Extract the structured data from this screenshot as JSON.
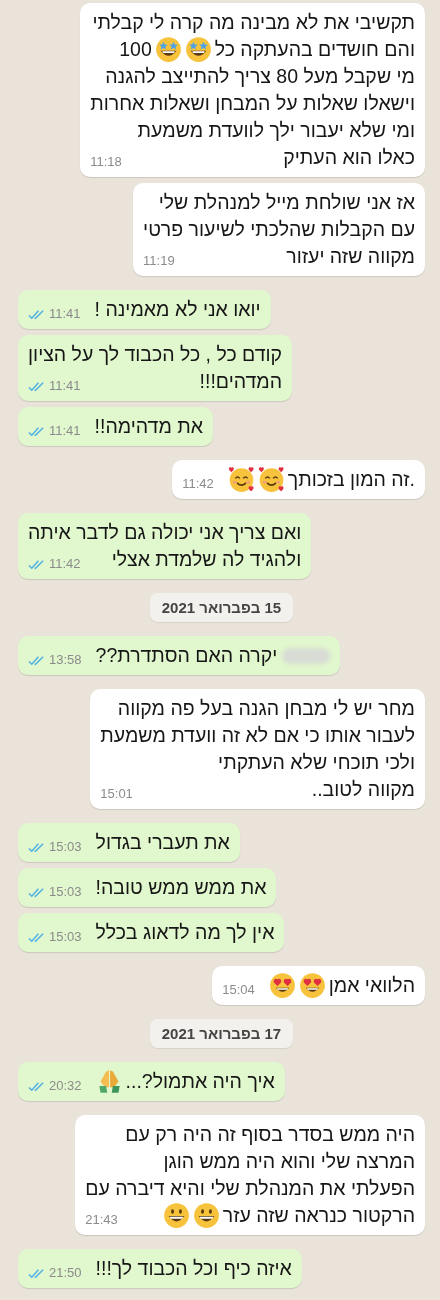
{
  "items": [
    {
      "kind": "message",
      "outgoing": false,
      "time": "11:18",
      "lines": [
        "תקשיבי את לא מבינה מה קרה לי קבלתי",
        [
          {
            "kind": "text",
            "text": "והם חושדים בהעתקה כל"
          },
          {
            "kind": "starstruck"
          },
          {
            "kind": "starstruck"
          },
          {
            "kind": "text",
            "text": "100"
          }
        ],
        "מי שקבל מעל 80 צריך להתייצב להגנה",
        "וישאלו שאלות על המבחן ושאלות אחרות",
        "ומי שלא יעבור ילך לוועדת משמעת",
        "כאלו הוא העתיק"
      ]
    },
    {
      "kind": "message",
      "outgoing": false,
      "time": "11:19",
      "lines": [
        "אז אני שולחת מייל למנהלת שלי",
        "עם הקבלות שהלכתי לשיעור פרטי",
        "מקווה שזה יעזור"
      ]
    },
    {
      "kind": "message",
      "outgoing": true,
      "time": "11:41",
      "lines": [
        "יואו אני לא מאמינה !"
      ]
    },
    {
      "kind": "message",
      "outgoing": true,
      "time": "11:41",
      "lines": [
        "קודם כל , כל הכבוד לך על הציון",
        "המדהים!!!"
      ]
    },
    {
      "kind": "message",
      "outgoing": true,
      "time": "11:41",
      "lines": [
        "את מדהימה!!"
      ]
    },
    {
      "kind": "message",
      "outgoing": false,
      "time": "11:42",
      "lines": [
        [
          {
            "kind": "text",
            "text": ".זה המון בזכותך"
          },
          {
            "kind": "hearts"
          },
          {
            "kind": "hearts"
          }
        ]
      ]
    },
    {
      "kind": "message",
      "outgoing": true,
      "time": "11:42",
      "lines": [
        "ואם צריך אני יכולה גם לדבר איתה",
        "ולהגיד לה שלמדת אצלי"
      ]
    },
    {
      "kind": "date",
      "text": "15 בפברואר 2021"
    },
    {
      "kind": "message",
      "outgoing": true,
      "time": "13:58",
      "lines": [
        [
          {
            "kind": "redacted"
          },
          {
            "kind": "text",
            "text": "יקרה האם הסתדרת??"
          }
        ]
      ]
    },
    {
      "kind": "message",
      "outgoing": false,
      "time": "15:01",
      "lines": [
        "מחר יש לי מבחן הגנה בעל פה מקווה",
        "לעבור אותו כי אם לא זה וועדת משמעת",
        "ולכי תוכחי שלא העתקתי",
        "מקווה לטוב.."
      ]
    },
    {
      "kind": "message",
      "outgoing": true,
      "time": "15:03",
      "lines": [
        "את תעברי בגדול"
      ]
    },
    {
      "kind": "message",
      "outgoing": true,
      "time": "15:03",
      "lines": [
        "את ממש ממש טובה!"
      ]
    },
    {
      "kind": "message",
      "outgoing": true,
      "time": "15:03",
      "lines": [
        "אין לך מה לדאוג בכלל"
      ]
    },
    {
      "kind": "message",
      "outgoing": false,
      "time": "15:04",
      "lines": [
        [
          {
            "kind": "text",
            "text": "הלוואי אמן"
          },
          {
            "kind": "hearteyes"
          },
          {
            "kind": "hearteyes"
          }
        ]
      ]
    },
    {
      "kind": "date",
      "text": "17 בפברואר 2021"
    },
    {
      "kind": "message",
      "outgoing": true,
      "time": "20:32",
      "lines": [
        [
          {
            "kind": "text",
            "text": "איך היה אתמול?..."
          },
          {
            "kind": "pray"
          }
        ]
      ]
    },
    {
      "kind": "message",
      "outgoing": false,
      "time": "21:43",
      "lines": [
        "היה ממש בסדר בסוף זה היה רק עם",
        "המרצה שלי והוא היה ממש הוגן",
        "הפעלתי את המנהלת שלי והיא דיברה עם",
        [
          {
            "kind": "text",
            "text": "הרקטור כנראה שזה עזר"
          },
          {
            "kind": "grin"
          },
          {
            "kind": "grin"
          }
        ]
      ]
    },
    {
      "kind": "message",
      "outgoing": true,
      "time": "21:50",
      "lines": [
        "איזה כיף וכל הכבוד לך!!!"
      ]
    }
  ]
}
